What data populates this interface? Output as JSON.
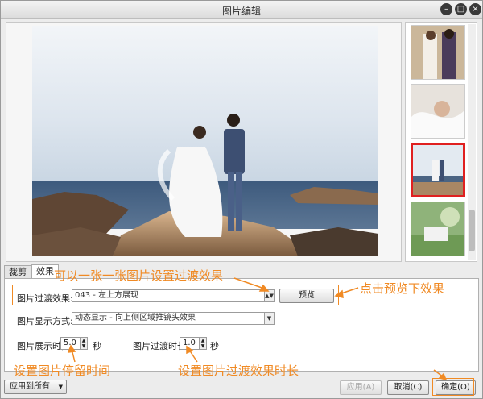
{
  "window": {
    "title": "图片编辑"
  },
  "tabs": [
    {
      "label": "裁剪"
    },
    {
      "label": "效果"
    }
  ],
  "form": {
    "transition_label": "图片过渡效果:",
    "transition_value": "043 - 左上方展现",
    "preview_button": "预览",
    "display_mode_label": "图片显示方式:",
    "display_mode_value": "动态显示 - 向上侧区域推镜头效果",
    "display_time_label": "图片展示时间:",
    "display_time_value": "5.0",
    "display_time_unit": "秒",
    "transition_time_label": "图片过渡时长:",
    "transition_time_value": "1.0",
    "transition_time_unit": "秒"
  },
  "footer": {
    "apply_all": "应用到所有",
    "apply": "应用(A)",
    "cancel": "取消(C)",
    "ok": "确定(O)"
  },
  "annotations": {
    "one_by_one": "可以一张一张图片设置过渡效果",
    "preview_hint": "点击预览下效果",
    "stay_time": "设置图片停留时间",
    "transition_duration": "设置图片过渡效果时长"
  },
  "colors": {
    "annotation": "#f08a24",
    "selected_thumb": "#e02020"
  },
  "icons": {
    "minimize": "minimize-icon",
    "maximize": "maximize-icon",
    "close": "close-icon"
  }
}
